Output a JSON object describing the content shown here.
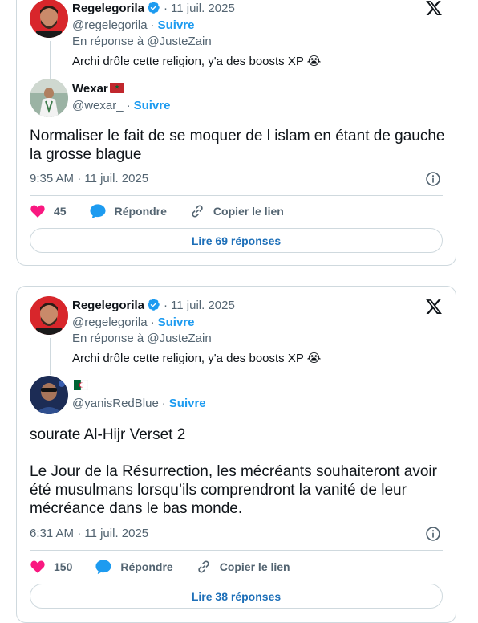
{
  "tweets": [
    {
      "parent": {
        "name": "Regelegorila",
        "handle": "@regelegorila",
        "date": "11 juil. 2025",
        "follow": "Suivre",
        "reply_to": "En réponse à @JusteZain",
        "text": "Archi drôle cette religion, y'a des boosts XP 😭"
      },
      "reply": {
        "name": "Wexar",
        "handle": "@wexar_",
        "follow": "Suivre",
        "flag_icon": "morocco-flag-icon",
        "text": "Normaliser le fait de se moquer de l islam en étant de gauche la grosse blague",
        "timestamp": "9:35 AM · 11 juil. 2025",
        "likes": "45",
        "reply_label": "Répondre",
        "copy_label": "Copier le lien",
        "read_replies": "Lire 69 réponses"
      }
    },
    {
      "parent": {
        "name": "Regelegorila",
        "handle": "@regelegorila",
        "date": "11 juil. 2025",
        "follow": "Suivre",
        "reply_to": "En réponse à @JusteZain",
        "text": "Archi drôle cette religion, y'a des boosts XP 😭"
      },
      "reply": {
        "name": "",
        "handle": "@yanisRedBlue",
        "follow": "Suivre",
        "flag_icon": "algeria-flag-icon",
        "text": "sourate Al-Hijr Verset 2\n\nLe Jour de la Résurrection, les mécréants souhaiteront avoir été musulmans lorsqu’ils comprendront la vanité de leur mécréance dans le bas monde.",
        "timestamp": "6:31 AM · 11 juil. 2025",
        "likes": "150",
        "reply_label": "Répondre",
        "copy_label": "Copier le lien",
        "read_replies": "Lire 38 réponses"
      }
    }
  ],
  "colors": {
    "accent": "#1d9bf0",
    "heart": "#f91880",
    "border": "#cfd9de",
    "muted": "#536471"
  }
}
